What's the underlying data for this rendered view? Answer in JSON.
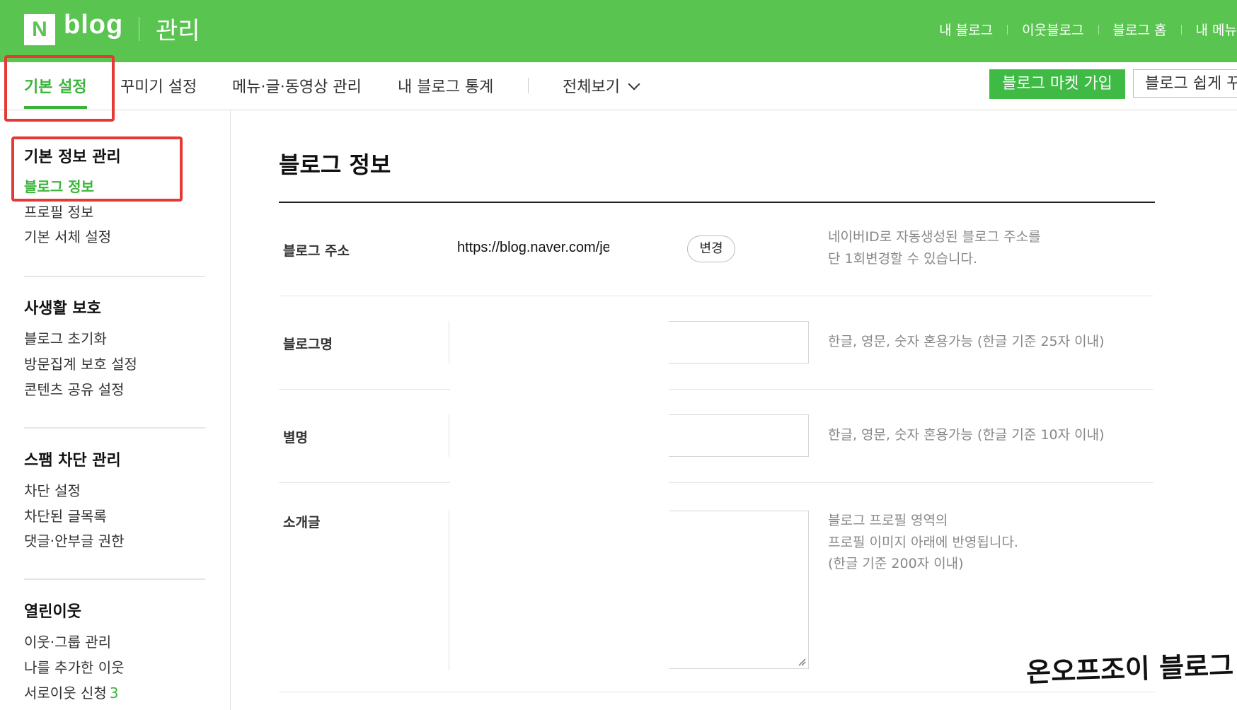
{
  "header": {
    "logo_mark": "N",
    "logo_text": "blog",
    "section_title": "관리",
    "nav": [
      "내 블로그",
      "이웃블로그",
      "블로그 홈",
      "내 메뉴"
    ]
  },
  "tabs": {
    "items": [
      "기본 설정",
      "꾸미기 설정",
      "메뉴·글·동영상 관리",
      "내 블로그 통계"
    ],
    "active_index": 0,
    "view_all": "전체보기",
    "market_button": "블로그 마켓 가입",
    "easy_button": "블로그 쉽게 꾸미기"
  },
  "sidebar": {
    "sections": [
      {
        "title": "기본 정보 관리",
        "items": [
          "블로그 정보",
          "프로필 정보",
          "기본 서체 설정"
        ]
      },
      {
        "title": "사생활 보호",
        "items": [
          "블로그 초기화",
          "방문집계 보호 설정",
          "콘텐츠 공유 설정"
        ]
      },
      {
        "title": "스팸 차단 관리",
        "items": [
          "차단 설정",
          "차단된 글목록",
          "댓글·안부글 권한"
        ]
      },
      {
        "title": "열린이웃",
        "items": [
          "이웃·그룹 관리",
          "나를 추가한 이웃",
          "서로이웃 신청"
        ],
        "request_count": "3"
      }
    ],
    "active_item": "블로그 정보"
  },
  "main": {
    "title": "블로그 정보",
    "address": {
      "label": "블로그 주소",
      "value": "https://blog.naver.com/je",
      "button": "변경",
      "help1": "네이버ID로 자동생성된 블로그 주소를",
      "help2": "단 1회변경할 수 있습니다."
    },
    "blog_name": {
      "label": "블로그명",
      "value": "",
      "help": "한글, 영문, 숫자 혼용가능 (한글 기준 25자 이내)"
    },
    "nickname": {
      "label": "별명",
      "value": "",
      "help": "한글, 영문, 숫자 혼용가능 (한글 기준 10자 이내)"
    },
    "intro": {
      "label": "소개글",
      "value": "",
      "help1": "블로그 프로필 영역의",
      "help2": "프로필 이미지 아래에 반영됩니다.",
      "help3": "(한글 기준 200자 이내)"
    }
  },
  "watermark": "온오프조이 블로그",
  "colors": {
    "brand_green": "#5ac451",
    "active_green": "#3cb43c",
    "marker_red": "#e53935"
  }
}
